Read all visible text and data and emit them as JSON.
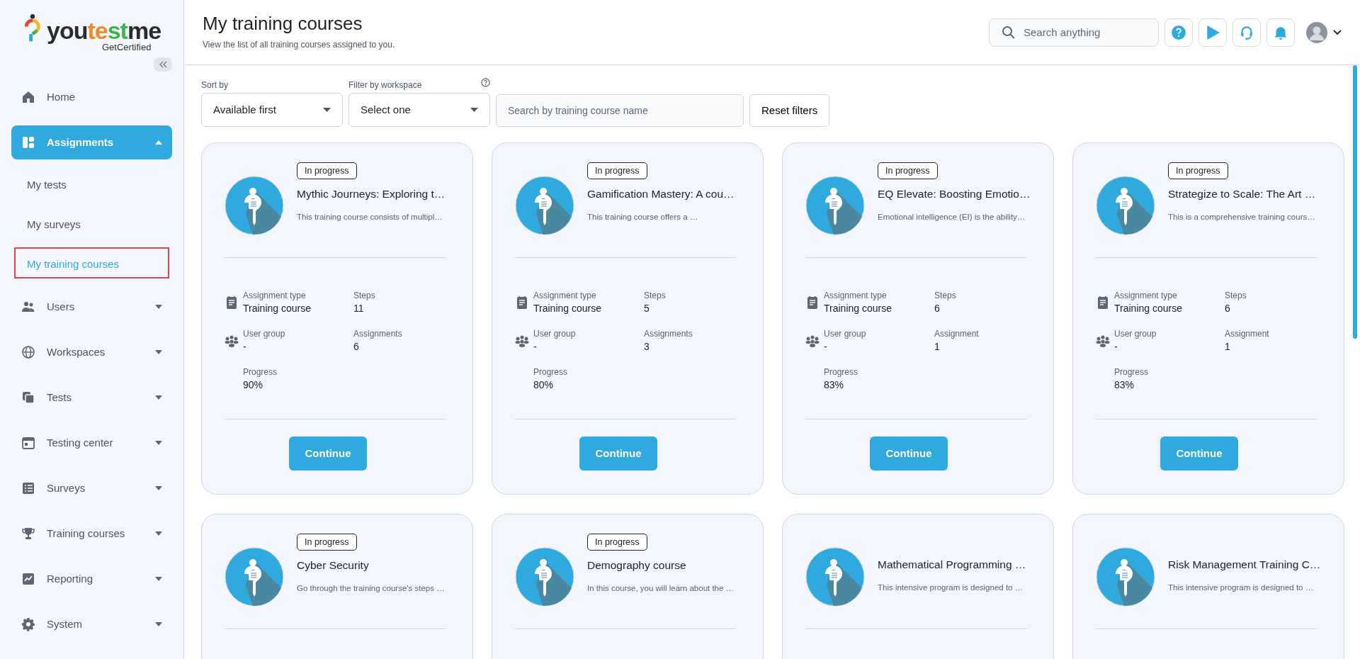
{
  "logo": {
    "segments": [
      {
        "text": "you",
        "color": "#2b2b2b"
      },
      {
        "text": "te",
        "color": "#f08a24"
      },
      {
        "text": "st",
        "color": "#3bb54a"
      },
      {
        "text": "me",
        "color": "#2b2b2b"
      }
    ],
    "tagline": "GetCertified"
  },
  "sidebar": {
    "items": [
      {
        "label": "Home",
        "selected": false
      },
      {
        "label": "Assignments",
        "selected": true,
        "expanded": true,
        "children": [
          {
            "label": "My tests",
            "selected": false
          },
          {
            "label": "My surveys",
            "selected": false
          },
          {
            "label": "My training courses",
            "selected": true
          }
        ]
      },
      {
        "label": "Users",
        "selected": false,
        "expanded": false
      },
      {
        "label": "Workspaces",
        "selected": false,
        "expanded": false
      },
      {
        "label": "Tests",
        "selected": false,
        "expanded": false
      },
      {
        "label": "Testing center",
        "selected": false,
        "expanded": false
      },
      {
        "label": "Surveys",
        "selected": false,
        "expanded": false
      },
      {
        "label": "Training courses",
        "selected": false,
        "expanded": false
      },
      {
        "label": "Reporting",
        "selected": false,
        "expanded": false
      },
      {
        "label": "System",
        "selected": false,
        "expanded": false
      }
    ]
  },
  "header": {
    "title": "My training courses",
    "subtitle": "View the list of all training courses assigned to you.",
    "search": {
      "placeholder": "Search anything"
    }
  },
  "filters": {
    "sort": {
      "label": "Sort by",
      "value": "Available first"
    },
    "workspace": {
      "label": "Filter by workspace",
      "value": "Select one"
    },
    "search": {
      "placeholder": "Search by training course name"
    },
    "reset": "Reset filters"
  },
  "courses": [
    {
      "status": "In progress",
      "title": "Mythic Journeys: Exploring t…",
      "description": "This training course consists of multipl…",
      "stats": [
        {
          "cells": [
            {
              "label": "Assignment type",
              "value": "Training course"
            },
            {
              "label": "Steps",
              "value": "11"
            }
          ]
        },
        {
          "cells": [
            {
              "label": "User group",
              "value": "-"
            },
            {
              "label": "Assignments",
              "value": "6"
            }
          ]
        },
        {
          "cells": [
            {
              "label": "Progress",
              "value": "90%"
            }
          ]
        }
      ],
      "button": "Continue"
    },
    {
      "status": "In progress",
      "title": "Gamification Mastery: A cou…",
      "description": "This training course offers a …",
      "stats": [
        {
          "cells": [
            {
              "label": "Assignment type",
              "value": "Training course"
            },
            {
              "label": "Steps",
              "value": "5"
            }
          ]
        },
        {
          "cells": [
            {
              "label": "User group",
              "value": "-"
            },
            {
              "label": "Assignments",
              "value": "3"
            }
          ]
        },
        {
          "cells": [
            {
              "label": "Progress",
              "value": "80%"
            }
          ]
        }
      ],
      "button": "Continue"
    },
    {
      "status": "In progress",
      "title": "EQ Elevate: Boosting Emotio…",
      "description": "Emotional intelligence (EI) is the ability…",
      "stats": [
        {
          "cells": [
            {
              "label": "Assignment type",
              "value": "Training course"
            },
            {
              "label": "Steps",
              "value": "6"
            }
          ]
        },
        {
          "cells": [
            {
              "label": "User group",
              "value": "-"
            },
            {
              "label": "Assignment",
              "value": "1"
            }
          ]
        },
        {
          "cells": [
            {
              "label": "Progress",
              "value": "83%"
            }
          ]
        }
      ],
      "button": "Continue"
    },
    {
      "status": "In progress",
      "title": "Strategize to Scale: The Art …",
      "description": "This is a comprehensive training cours…",
      "stats": [
        {
          "cells": [
            {
              "label": "Assignment type",
              "value": "Training course"
            },
            {
              "label": "Steps",
              "value": "6"
            }
          ]
        },
        {
          "cells": [
            {
              "label": "User group",
              "value": "-"
            },
            {
              "label": "Assignment",
              "value": "1"
            }
          ]
        },
        {
          "cells": [
            {
              "label": "Progress",
              "value": "83%"
            }
          ]
        }
      ],
      "button": "Continue"
    },
    {
      "status": "In progress",
      "title": "Cyber Security",
      "description": "Go through the training course's steps …"
    },
    {
      "status": "In progress",
      "title": "Demography course",
      "description": "In this course, you will learn about the …"
    },
    {
      "title": "Mathematical Programming …",
      "description": "This intensive program is designed to …"
    },
    {
      "title": "Risk Management Training C…",
      "description": "This intensive program is designed to …"
    }
  ]
}
